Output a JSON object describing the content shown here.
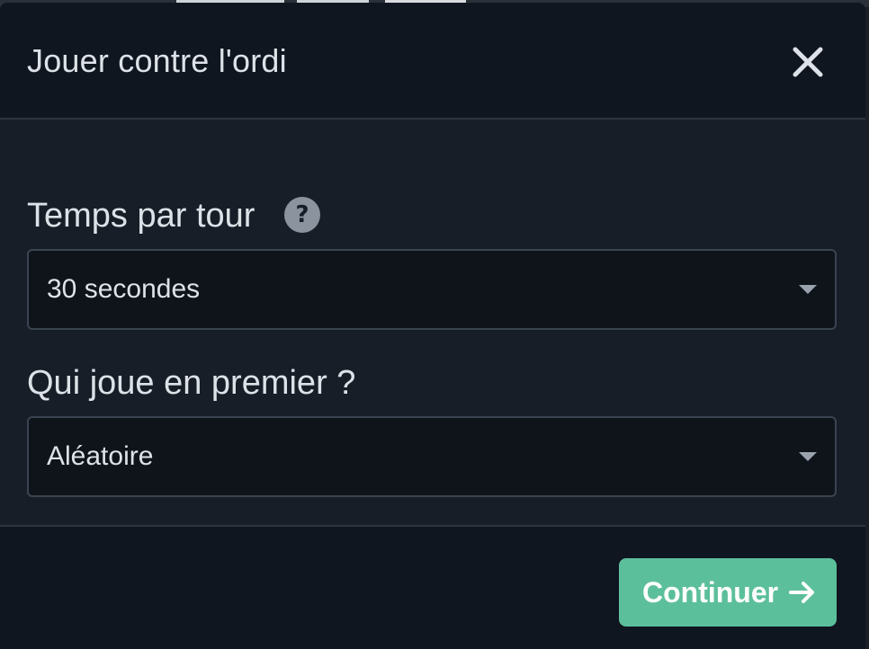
{
  "modal": {
    "title": "Jouer contre l'ordi",
    "close_icon": "close-icon"
  },
  "fields": {
    "time_per_turn": {
      "label": "Temps par tour",
      "help_icon": "question-mark-icon",
      "help_glyph": "?",
      "value": "30 secondes"
    },
    "who_plays_first": {
      "label": "Qui joue en premier ?",
      "value": "Aléatoire"
    }
  },
  "footer": {
    "continue_label": "Continuer",
    "continue_icon": "arrow-right-icon"
  },
  "colors": {
    "accent": "#5cbf9b",
    "modal_bg": "#171e27",
    "header_bg": "#101620",
    "text": "#dde2e8"
  }
}
